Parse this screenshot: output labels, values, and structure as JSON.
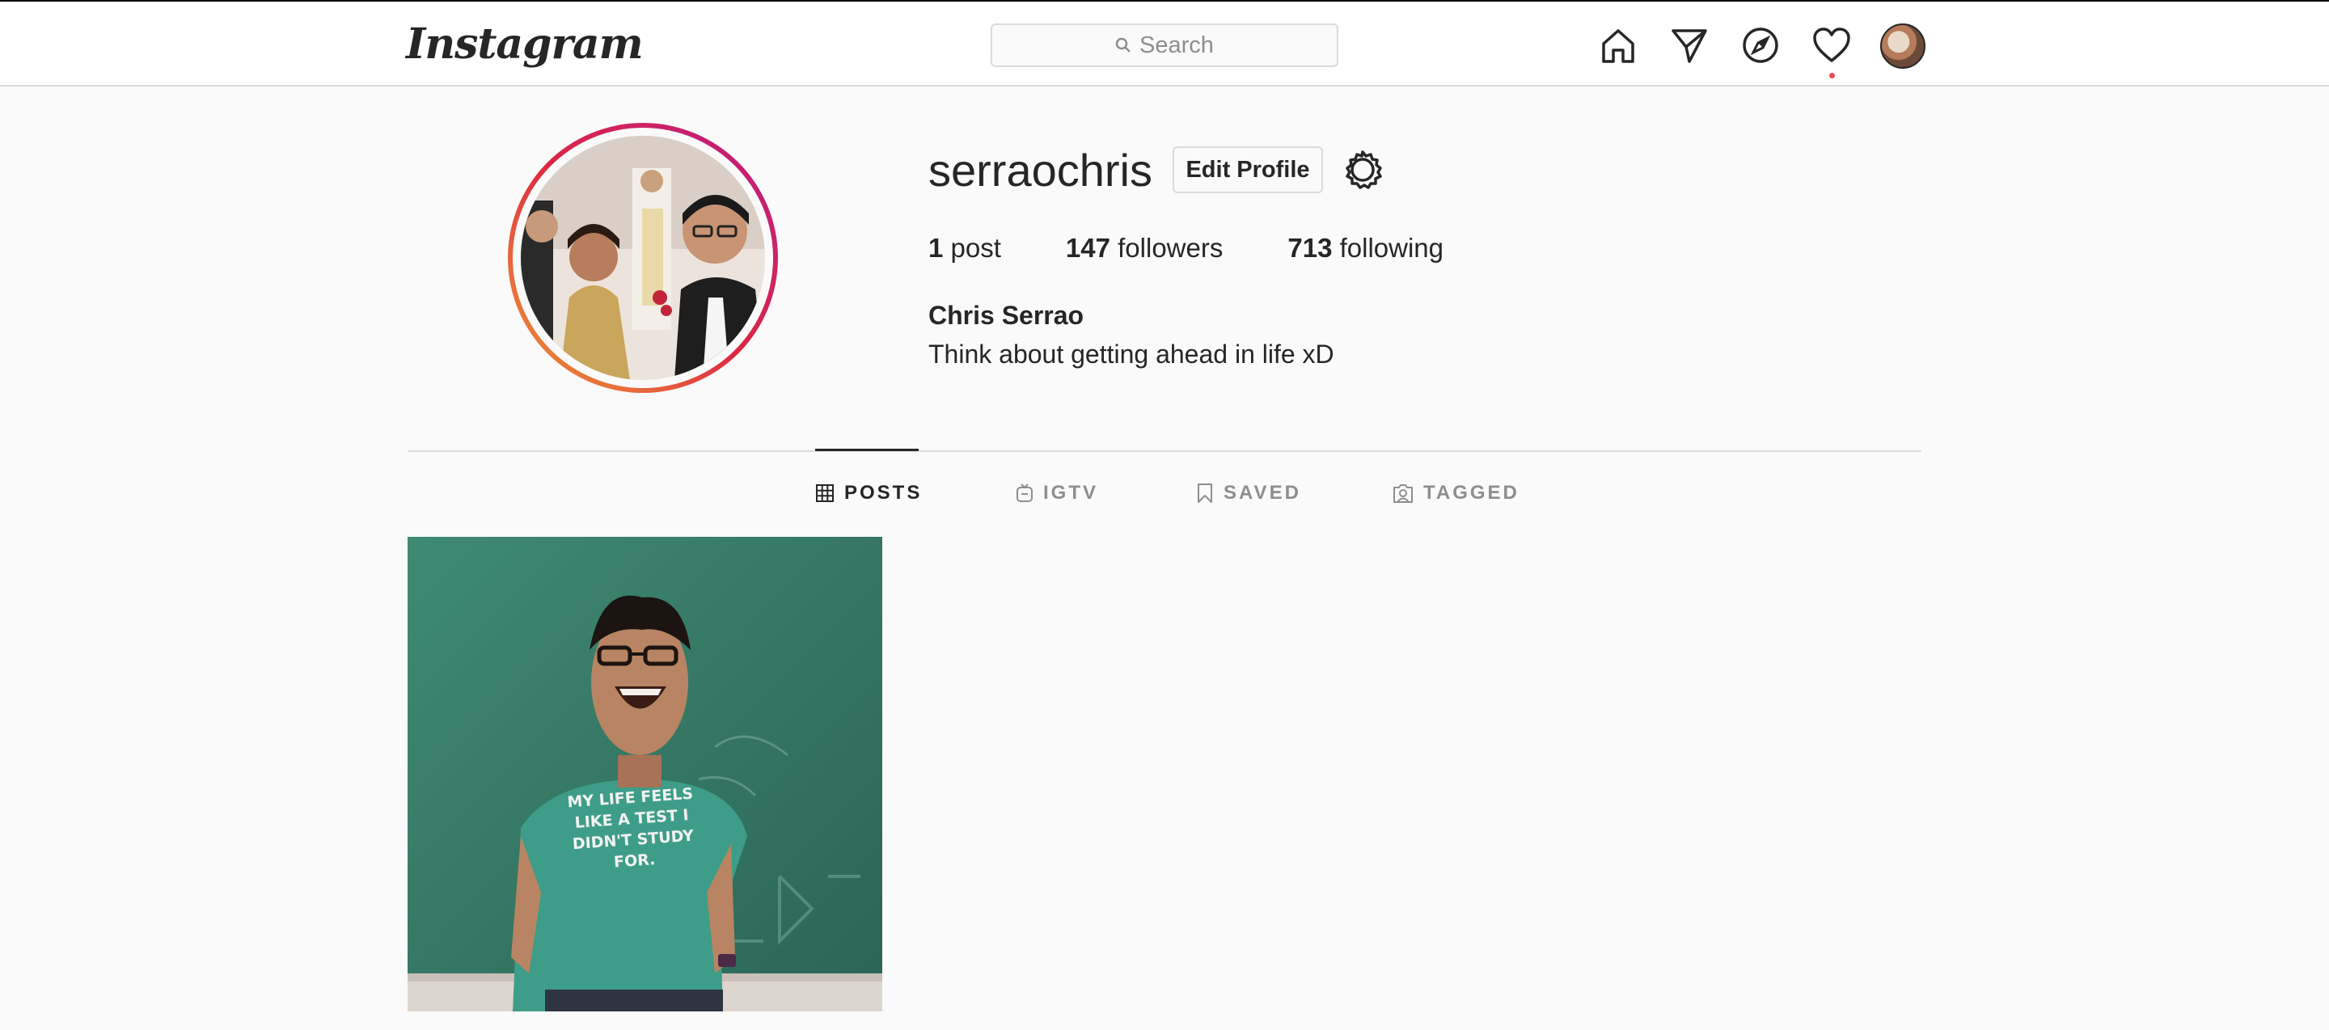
{
  "header": {
    "logo": "Instagram",
    "search_placeholder": "Search"
  },
  "profile": {
    "username": "serraochris",
    "edit_label": "Edit Profile",
    "posts_count": "1",
    "posts_label": "post",
    "followers_count": "147",
    "followers_label": "followers",
    "following_count": "713",
    "following_label": "following",
    "full_name": "Chris Serrao",
    "bio": "Think about getting ahead in life xD"
  },
  "tabs": [
    {
      "label": "POSTS",
      "icon": "grid-icon",
      "active": true
    },
    {
      "label": "IGTV",
      "icon": "igtv-icon",
      "active": false
    },
    {
      "label": "SAVED",
      "icon": "bookmark-icon",
      "active": false
    },
    {
      "label": "TAGGED",
      "icon": "tag-person-icon",
      "active": false
    }
  ],
  "post": {
    "shirt_text": "MY LIFE FEELS LIKE A TEST I DIDN'T STUDY FOR."
  },
  "colors": {
    "notification_dot": "#ed4956",
    "border": "#dbdbdb",
    "text": "#262626",
    "muted": "#8e8e8e"
  }
}
